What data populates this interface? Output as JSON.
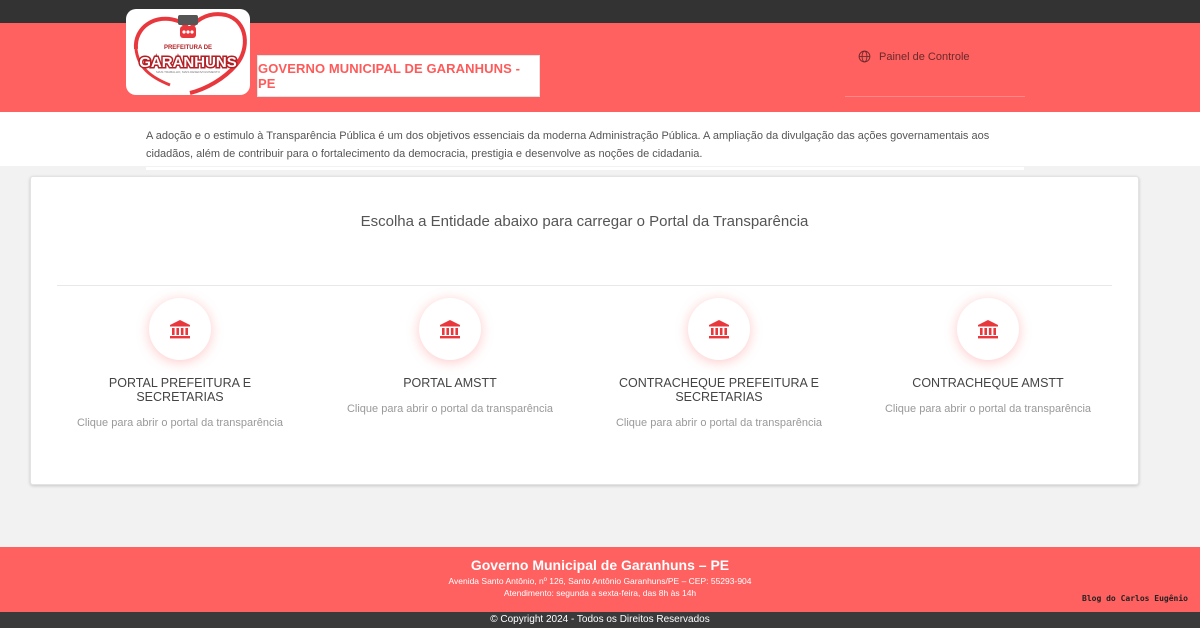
{
  "header": {
    "logo_text": "PREFEITURA DE GARANHUNS",
    "logo_tagline": "MAIS TRABALHO, MAIS DESENVOLVIMENTO",
    "title": "GOVERNO MUNICIPAL DE GARANHUNS - PE",
    "painel_label": "Painel de Controle",
    "painel_icon": "globe-icon"
  },
  "intro": {
    "text": "A adoção e o estimulo à Transparência Pública é um dos objetivos essenciais da moderna Administração Pública. A ampliação da divulgação das ações governamentais aos cidadãos, além de contribuir para o fortalecimento da democracia, prestigia e desenvolve as noções de cidadania."
  },
  "main": {
    "heading": "Escolha a Entidade abaixo para carregar o Portal da Transparência",
    "entities": [
      {
        "icon": "institution-icon",
        "label": "PORTAL PREFEITURA E SECRETARIAS",
        "sub": "Clique para abrir o portal da transparência"
      },
      {
        "icon": "institution-icon",
        "label": "PORTAL AMSTT",
        "sub": "Clique para abrir o portal da transparência"
      },
      {
        "icon": "institution-icon",
        "label": "CONTRACHEQUE PREFEITURA E SECRETARIAS",
        "sub": "Clique para abrir o portal da transparência"
      },
      {
        "icon": "institution-icon",
        "label": "CONTRACHEQUE AMSTT",
        "sub": "Clique para abrir o portal da transparência"
      }
    ]
  },
  "footer": {
    "title": "Governo Municipal de Garanhuns – PE",
    "address": "Avenida Santo Antônio, nº 126, Santo Antônio Garanhuns/PE – CEP: 55293-904",
    "hours": "Atendimento: segunda a sexta-feira, das 8h às 14h",
    "copyright": "© Copyright 2024  - Todos os Direitos Reservados"
  },
  "watermark": "Blog do Carlos Eugênio",
  "colors": {
    "accent": "#ff6060",
    "dark_bar": "#333333",
    "icon_red": "#e8383d"
  }
}
